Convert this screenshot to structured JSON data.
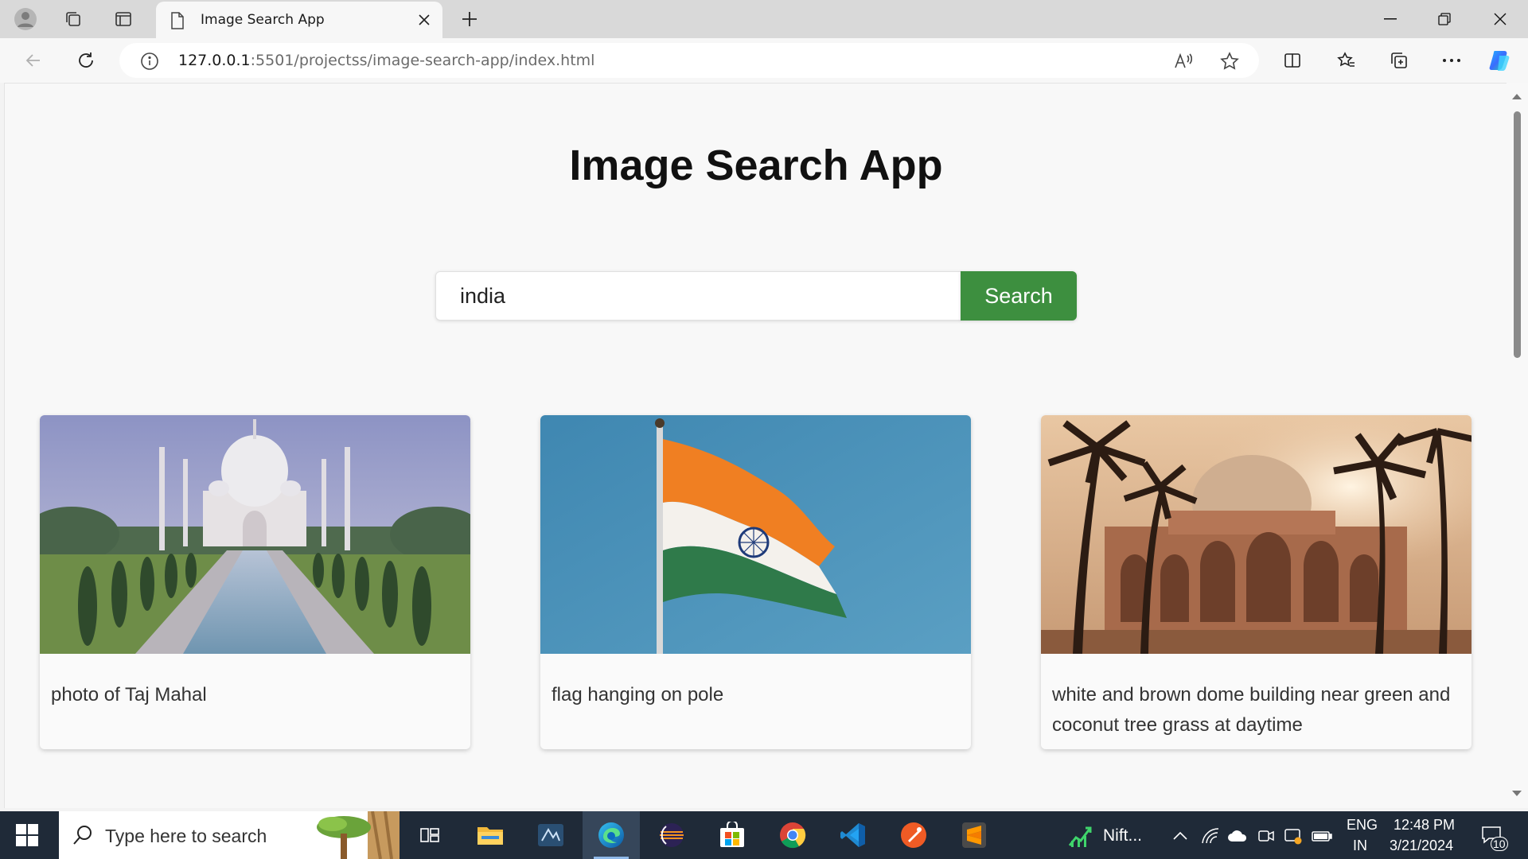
{
  "browser": {
    "tab_title": "Image Search App",
    "url_host": "127.0.0.1",
    "url_path": ":5501/projectss/image-search-app/index.html"
  },
  "page": {
    "title": "Image Search App",
    "search_value": "india",
    "search_button": "Search",
    "results": [
      {
        "caption": "photo of Taj Mahal",
        "image": "taj-mahal-photo"
      },
      {
        "caption": "flag hanging on pole",
        "image": "india-flag-photo"
      },
      {
        "caption": "white and brown dome building near green and coconut tree grass at daytime",
        "image": "dome-building-photo"
      }
    ]
  },
  "taskbar": {
    "search_placeholder": "Type here to search",
    "stock_widget": "Nift...",
    "language": "ENG",
    "region": "IN",
    "time": "12:48 PM",
    "date": "3/21/2024",
    "notification_count": "10"
  },
  "colors": {
    "accent_green": "#3d8f3f",
    "taskbar_bg": "#1f2a38"
  }
}
